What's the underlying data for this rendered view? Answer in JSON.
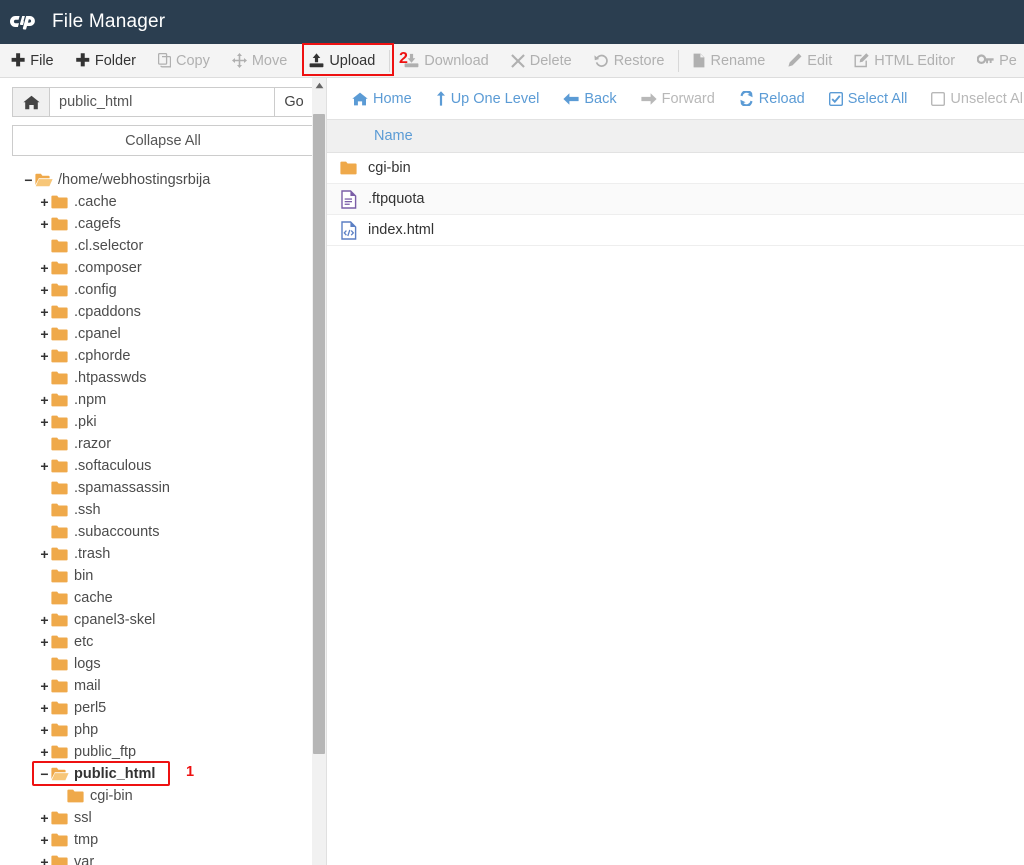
{
  "header": {
    "logo": "cpanel-logo",
    "title": "File Manager",
    "bg_color": "#2b3e50"
  },
  "action_bar": {
    "buttons": [
      {
        "label": "File",
        "icon": "plus-icon",
        "enabled": true
      },
      {
        "label": "Folder",
        "icon": "plus-icon",
        "enabled": true
      },
      {
        "label": "Copy",
        "icon": "copy-icon",
        "enabled": false
      },
      {
        "label": "Move",
        "icon": "move-icon",
        "enabled": false
      },
      {
        "label": "Upload",
        "icon": "upload-icon",
        "enabled": true
      },
      {
        "label": "Download",
        "icon": "download-icon",
        "enabled": false
      },
      {
        "label": "Delete",
        "icon": "delete-x-icon",
        "enabled": false
      },
      {
        "label": "Restore",
        "icon": "restore-icon",
        "enabled": false
      },
      {
        "label": "Rename",
        "icon": "rename-file-icon",
        "enabled": false
      },
      {
        "label": "Edit",
        "icon": "pencil-icon",
        "enabled": false
      },
      {
        "label": "HTML Editor",
        "icon": "html-editor-icon",
        "enabled": false
      },
      {
        "label": "Pe",
        "icon": "key-icon",
        "enabled": false
      }
    ]
  },
  "annotations": {
    "step1_number": "1",
    "step2_number": "2",
    "color": "#ee1111"
  },
  "sidebar": {
    "path_value": "public_html",
    "path_placeholder": "public_html",
    "home_icon": "home-icon",
    "go_label": "Go",
    "collapse_label": "Collapse All",
    "tree": [
      {
        "label": "/home/webhostingsrbija",
        "depth": 0,
        "toggle": "-",
        "icon": "folder-open-icon",
        "selected": false
      },
      {
        "label": ".cache",
        "depth": 1,
        "toggle": "+",
        "icon": "folder-icon",
        "selected": false
      },
      {
        "label": ".cagefs",
        "depth": 1,
        "toggle": "+",
        "icon": "folder-icon",
        "selected": false
      },
      {
        "label": ".cl.selector",
        "depth": 1,
        "toggle": "",
        "icon": "folder-icon",
        "selected": false
      },
      {
        "label": ".composer",
        "depth": 1,
        "toggle": "+",
        "icon": "folder-icon",
        "selected": false
      },
      {
        "label": ".config",
        "depth": 1,
        "toggle": "+",
        "icon": "folder-icon",
        "selected": false
      },
      {
        "label": ".cpaddons",
        "depth": 1,
        "toggle": "+",
        "icon": "folder-icon",
        "selected": false
      },
      {
        "label": ".cpanel",
        "depth": 1,
        "toggle": "+",
        "icon": "folder-icon",
        "selected": false
      },
      {
        "label": ".cphorde",
        "depth": 1,
        "toggle": "+",
        "icon": "folder-icon",
        "selected": false
      },
      {
        "label": ".htpasswds",
        "depth": 1,
        "toggle": "",
        "icon": "folder-icon",
        "selected": false
      },
      {
        "label": ".npm",
        "depth": 1,
        "toggle": "+",
        "icon": "folder-icon",
        "selected": false
      },
      {
        "label": ".pki",
        "depth": 1,
        "toggle": "+",
        "icon": "folder-icon",
        "selected": false
      },
      {
        "label": ".razor",
        "depth": 1,
        "toggle": "",
        "icon": "folder-icon",
        "selected": false
      },
      {
        "label": ".softaculous",
        "depth": 1,
        "toggle": "+",
        "icon": "folder-icon",
        "selected": false
      },
      {
        "label": ".spamassassin",
        "depth": 1,
        "toggle": "",
        "icon": "folder-icon",
        "selected": false
      },
      {
        "label": ".ssh",
        "depth": 1,
        "toggle": "",
        "icon": "folder-icon",
        "selected": false
      },
      {
        "label": ".subaccounts",
        "depth": 1,
        "toggle": "",
        "icon": "folder-icon",
        "selected": false
      },
      {
        "label": ".trash",
        "depth": 1,
        "toggle": "+",
        "icon": "folder-icon",
        "selected": false
      },
      {
        "label": "bin",
        "depth": 1,
        "toggle": "",
        "icon": "folder-icon",
        "selected": false
      },
      {
        "label": "cache",
        "depth": 1,
        "toggle": "",
        "icon": "folder-icon",
        "selected": false
      },
      {
        "label": "cpanel3-skel",
        "depth": 1,
        "toggle": "+",
        "icon": "folder-icon",
        "selected": false
      },
      {
        "label": "etc",
        "depth": 1,
        "toggle": "+",
        "icon": "folder-icon",
        "selected": false
      },
      {
        "label": "logs",
        "depth": 1,
        "toggle": "",
        "icon": "folder-icon",
        "selected": false
      },
      {
        "label": "mail",
        "depth": 1,
        "toggle": "+",
        "icon": "folder-icon",
        "selected": false
      },
      {
        "label": "perl5",
        "depth": 1,
        "toggle": "+",
        "icon": "folder-icon",
        "selected": false
      },
      {
        "label": "php",
        "depth": 1,
        "toggle": "+",
        "icon": "folder-icon",
        "selected": false
      },
      {
        "label": "public_ftp",
        "depth": 1,
        "toggle": "+",
        "icon": "folder-icon",
        "selected": false
      },
      {
        "label": "public_html",
        "depth": 1,
        "toggle": "-",
        "icon": "folder-open-icon",
        "selected": true
      },
      {
        "label": "cgi-bin",
        "depth": 2,
        "toggle": "",
        "icon": "folder-icon",
        "selected": false
      },
      {
        "label": "ssl",
        "depth": 1,
        "toggle": "+",
        "icon": "folder-icon",
        "selected": false
      },
      {
        "label": "tmp",
        "depth": 1,
        "toggle": "+",
        "icon": "folder-icon",
        "selected": false
      },
      {
        "label": "var",
        "depth": 1,
        "toggle": "+",
        "icon": "folder-icon",
        "selected": false
      }
    ]
  },
  "main": {
    "nav_buttons": [
      {
        "label": "Home",
        "icon": "home-icon",
        "enabled": true
      },
      {
        "label": "Up One Level",
        "icon": "up-arrow-icon",
        "enabled": true
      },
      {
        "label": "Back",
        "icon": "arrow-left-icon",
        "enabled": true
      },
      {
        "label": "Forward",
        "icon": "arrow-right-icon",
        "enabled": false
      },
      {
        "label": "Reload",
        "icon": "reload-icon",
        "enabled": true
      },
      {
        "label": "Select All",
        "icon": "checkbox-checked-icon",
        "enabled": true
      },
      {
        "label": "Unselect All",
        "icon": "checkbox-empty-icon",
        "enabled": false
      }
    ],
    "columns": [
      "Name"
    ],
    "files": [
      {
        "name": "cgi-bin",
        "icon": "folder-icon"
      },
      {
        "name": ".ftpquota",
        "icon": "document-icon"
      },
      {
        "name": "index.html",
        "icon": "html-file-icon"
      }
    ]
  }
}
